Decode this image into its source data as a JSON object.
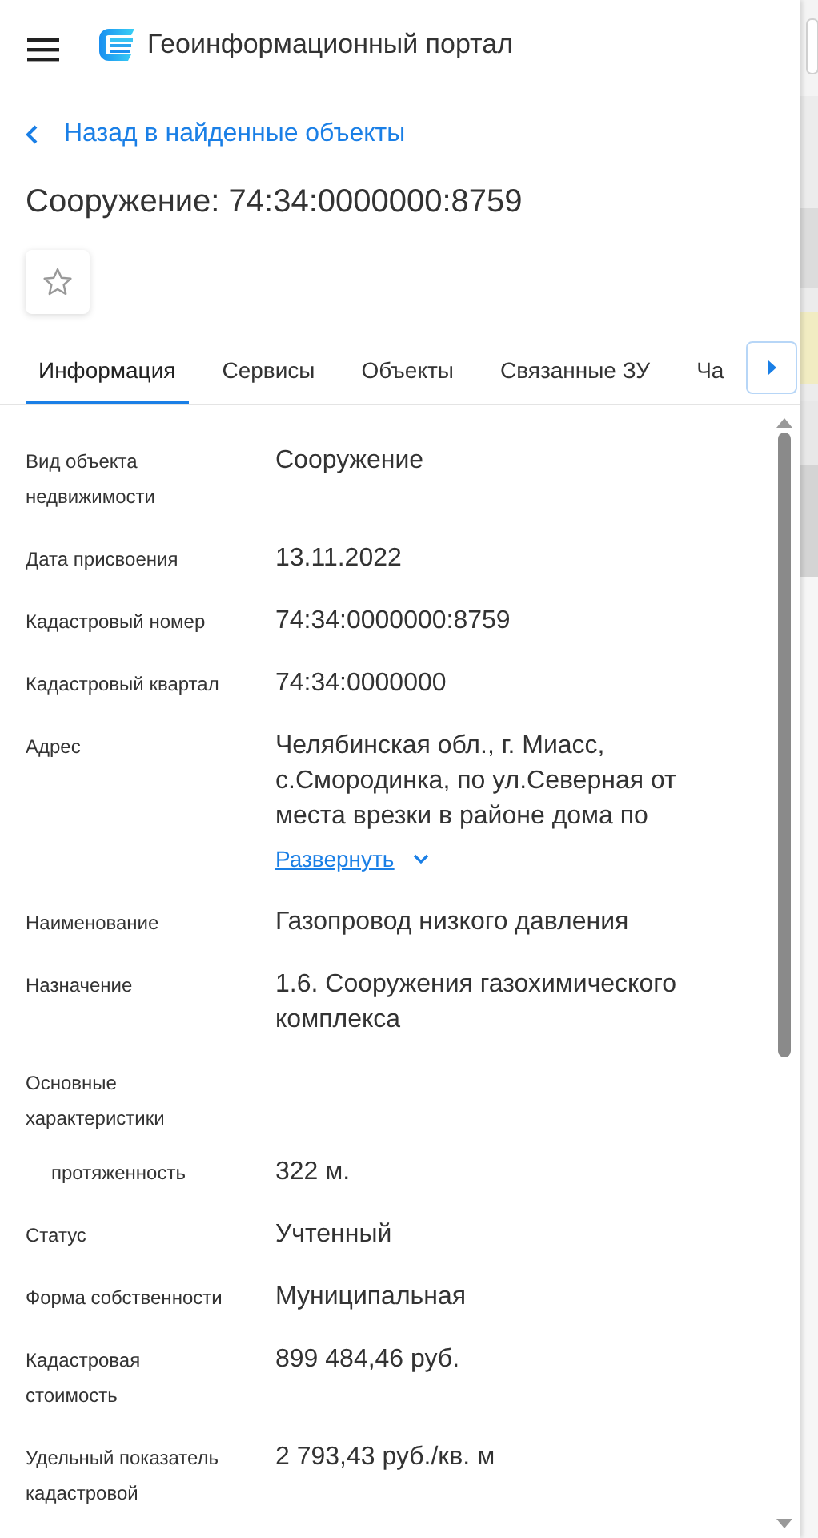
{
  "header": {
    "title": "Геоинформационный портал"
  },
  "back_link": "Назад в найденные объекты",
  "object_title": "Сооружение: 74:34:0000000:8759",
  "favorite": {
    "on": false
  },
  "tabs": [
    {
      "label": "Информация",
      "selected": true
    },
    {
      "label": "Сервисы",
      "selected": false
    },
    {
      "label": "Объекты",
      "selected": false
    },
    {
      "label": "Связанные ЗУ",
      "selected": false
    },
    {
      "label": "Ча",
      "selected": false
    }
  ],
  "properties": [
    {
      "kind": "field",
      "label": "Вид объекта недвижимости",
      "value": "Сооружение"
    },
    {
      "kind": "field",
      "label": "Дата присвоения",
      "value": "13.11.2022"
    },
    {
      "kind": "field",
      "label": "Кадастровый номер",
      "value": "74:34:0000000:8759"
    },
    {
      "kind": "field",
      "label": "Кадастровый квартал",
      "value": "74:34:0000000"
    },
    {
      "kind": "field",
      "label": "Адрес",
      "value": "Челябинская обл., г. Миасс, с.Смородинка, по ул.Северная от места врезки в районе дома по",
      "expand_link": "Развернуть"
    },
    {
      "kind": "field",
      "label": "Наименование",
      "value": "Газопровод низкого давления"
    },
    {
      "kind": "field",
      "label": "Назначение",
      "value": "1.6. Сооружения газохимического комплекса"
    },
    {
      "kind": "group",
      "label": "Основные характеристики"
    },
    {
      "kind": "sub",
      "label": "протяженность",
      "value": "322 м."
    },
    {
      "kind": "field",
      "label": "Статус",
      "value": "Учтенный"
    },
    {
      "kind": "field",
      "label": "Форма собственности",
      "value": "Муниципальная"
    },
    {
      "kind": "field",
      "label": "Кадастровая стоимость",
      "value": "899 484,46 руб."
    },
    {
      "kind": "field",
      "label": "Удельный показатель кадастровой",
      "value": "2 793,43 руб./кв. м"
    }
  ]
}
